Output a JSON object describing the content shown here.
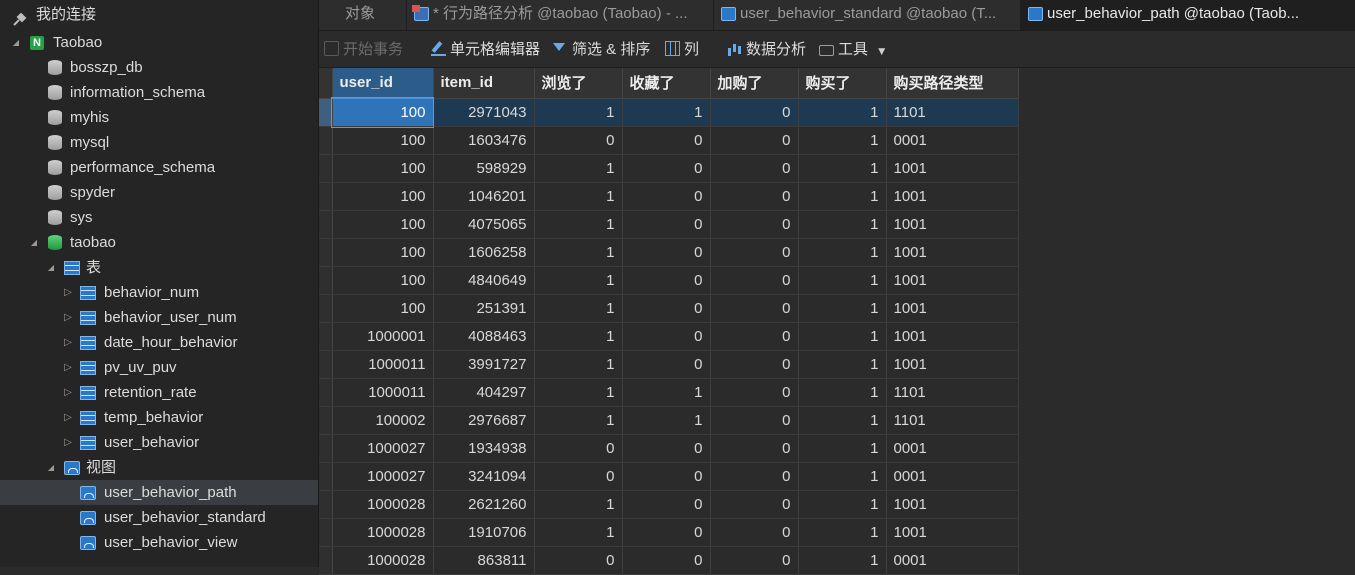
{
  "sidebar": {
    "header": "我的连接",
    "connection": "Taobao",
    "databases": [
      "bosszp_db",
      "information_schema",
      "myhis",
      "mysql",
      "performance_schema",
      "spyder",
      "sys"
    ],
    "active_db": "taobao",
    "tables_group": "表",
    "tables": [
      "behavior_num",
      "behavior_user_num",
      "date_hour_behavior",
      "pv_uv_puv",
      "retention_rate",
      "temp_behavior",
      "user_behavior"
    ],
    "views_group": "视图",
    "views": [
      "user_behavior_path",
      "user_behavior_standard",
      "user_behavior_view"
    ],
    "selected_view": "user_behavior_path"
  },
  "tabs": [
    {
      "label": "对象",
      "icon": "none"
    },
    {
      "label": "* 行为路径分析 @taobao (Taobao) - ...",
      "icon": "query-icon"
    },
    {
      "label": "user_behavior_standard @taobao (T...",
      "icon": "view-icon"
    },
    {
      "label": "user_behavior_path @taobao (Taob...",
      "icon": "view-icon",
      "active": true
    }
  ],
  "toolbar": {
    "begin_transaction": "开始事务",
    "cell_editor": "单元格编辑器",
    "filter_sort": "筛选 & 排序",
    "columns": "列",
    "data_analysis": "数据分析",
    "tools": "工具"
  },
  "grid": {
    "columns": [
      "user_id",
      "item_id",
      "浏览了",
      "收藏了",
      "加购了",
      "购买了",
      "购买路径类型"
    ],
    "rows": [
      [
        "100",
        "2971043",
        "1",
        "1",
        "0",
        "1",
        "1101"
      ],
      [
        "100",
        "1603476",
        "0",
        "0",
        "0",
        "1",
        "0001"
      ],
      [
        "100",
        "598929",
        "1",
        "0",
        "0",
        "1",
        "1001"
      ],
      [
        "100",
        "1046201",
        "1",
        "0",
        "0",
        "1",
        "1001"
      ],
      [
        "100",
        "4075065",
        "1",
        "0",
        "0",
        "1",
        "1001"
      ],
      [
        "100",
        "1606258",
        "1",
        "0",
        "0",
        "1",
        "1001"
      ],
      [
        "100",
        "4840649",
        "1",
        "0",
        "0",
        "1",
        "1001"
      ],
      [
        "100",
        "251391",
        "1",
        "0",
        "0",
        "1",
        "1001"
      ],
      [
        "1000001",
        "4088463",
        "1",
        "0",
        "0",
        "1",
        "1001"
      ],
      [
        "1000011",
        "3991727",
        "1",
        "0",
        "0",
        "1",
        "1001"
      ],
      [
        "1000011",
        "404297",
        "1",
        "1",
        "0",
        "1",
        "1101"
      ],
      [
        "100002",
        "2976687",
        "1",
        "1",
        "0",
        "1",
        "1101"
      ],
      [
        "1000027",
        "1934938",
        "0",
        "0",
        "0",
        "1",
        "0001"
      ],
      [
        "1000027",
        "3241094",
        "0",
        "0",
        "0",
        "1",
        "0001"
      ],
      [
        "1000028",
        "2621260",
        "1",
        "0",
        "0",
        "1",
        "1001"
      ],
      [
        "1000028",
        "1910706",
        "1",
        "0",
        "0",
        "1",
        "1001"
      ],
      [
        "1000028",
        "863811",
        "0",
        "0",
        "0",
        "1",
        "0001"
      ]
    ]
  }
}
